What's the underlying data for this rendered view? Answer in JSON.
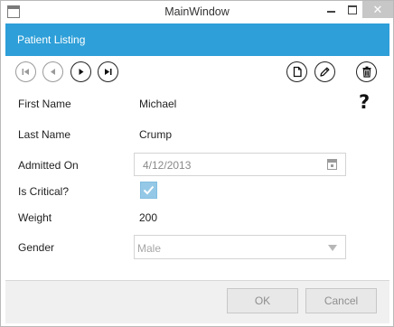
{
  "window": {
    "title": "MainWindow",
    "close_glyph": "✕"
  },
  "header": {
    "title": "Patient Listing"
  },
  "toolbar": {
    "icons": [
      "first-record-icon",
      "previous-record-icon",
      "next-record-icon",
      "last-record-icon",
      "new-record-icon",
      "edit-icon",
      "delete-icon"
    ]
  },
  "help": {
    "glyph": "?"
  },
  "form": {
    "first_name": {
      "label": "First Name",
      "value": "Michael"
    },
    "last_name": {
      "label": "Last Name",
      "value": "Crump"
    },
    "admitted_on": {
      "label": "Admitted On",
      "value": "4/12/2013"
    },
    "is_critical": {
      "label": "Is Critical?",
      "checked": true
    },
    "weight": {
      "label": "Weight",
      "value": "200"
    },
    "gender": {
      "label": "Gender",
      "value": "Male"
    }
  },
  "footer": {
    "ok_label": "OK",
    "cancel_label": "Cancel"
  },
  "colors": {
    "header_bg": "#2e9fd8",
    "checkbox_bg": "#94c8e6"
  }
}
